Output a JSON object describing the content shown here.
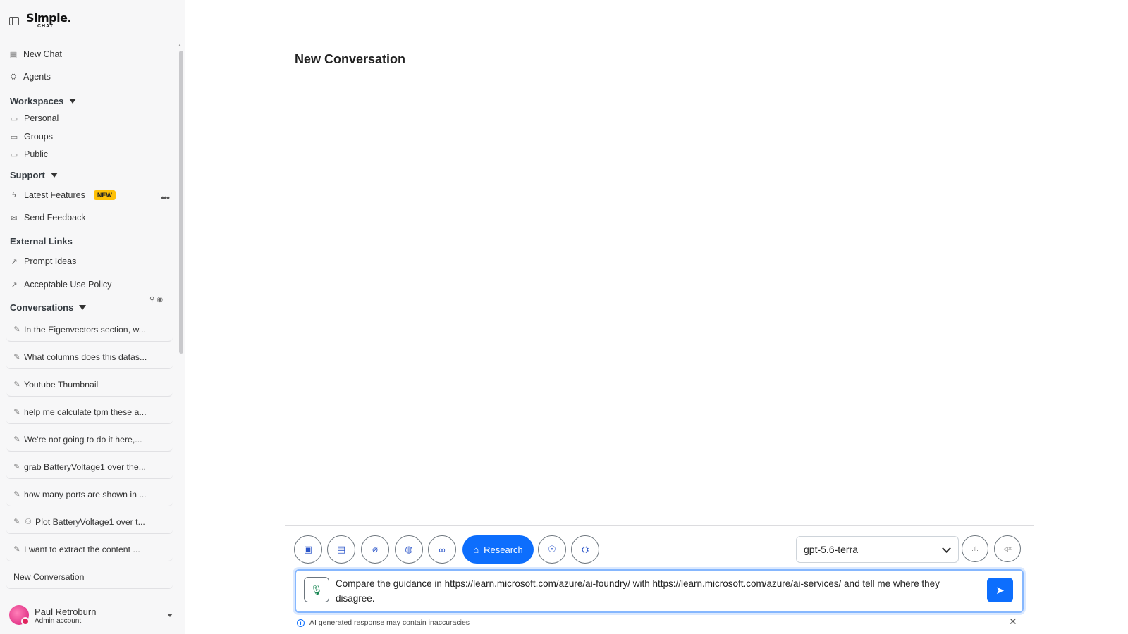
{
  "app": {
    "logo_line1": "Simple.",
    "logo_line2": "CHAT"
  },
  "sidebar": {
    "new_chat": "New Chat",
    "agents": "Agents",
    "workspaces_heading": "Workspaces",
    "workspaces": [
      "Personal",
      "Groups",
      "Public"
    ],
    "support_heading": "Support",
    "latest_features": "Latest Features",
    "new_badge": "NEW",
    "send_feedback": "Send Feedback",
    "external_heading": "External Links",
    "prompt_ideas": "Prompt Ideas",
    "acceptable_use": "Acceptable Use Policy",
    "conversations_heading": "Conversations",
    "conversations": [
      "In the Eigenvectors section, w...",
      "What columns does this datas...",
      "Youtube Thumbnail",
      "help me calculate tpm these a...",
      "We're not going to do it here,...",
      "grab BatteryVoltage1 over the...",
      "how many ports are shown in ...",
      "Plot BatteryVoltage1 over t...",
      "I want to extract the content ...",
      "New Conversation"
    ]
  },
  "user": {
    "name": "Paul Retroburn",
    "role": "Admin account"
  },
  "main": {
    "title": "New Conversation",
    "research_label": "Research",
    "model": "gpt-5.6-terra",
    "input_text": "Compare the guidance in https://learn.microsoft.com/azure/ai-foundry/ with https://learn.microsoft.com/azure/ai-services/ and tell me where they disagree.",
    "disclaimer": "AI generated response may contain inaccuracies"
  },
  "colors": {
    "accent": "#0d6efd",
    "badge": "#ffc107",
    "mic": "#198754"
  }
}
